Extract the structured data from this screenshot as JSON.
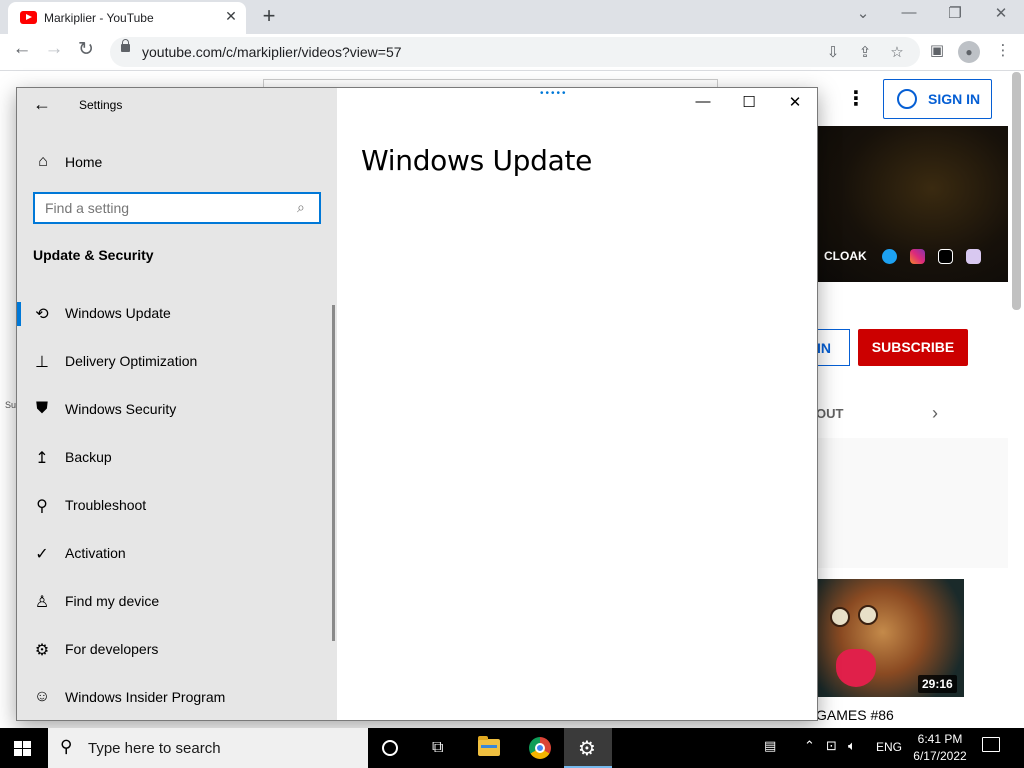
{
  "browser": {
    "tab_title": "Markiplier - YouTube",
    "tab_close_glyph": "✕",
    "new_tab_glyph": "+",
    "url": "youtube.com/c/markiplier/videos?view=57",
    "window_buttons": {
      "chevron": "⌄",
      "minimize": "—",
      "restore": "❐",
      "close": "✕"
    }
  },
  "youtube": {
    "sign_in_label": "SIGN IN",
    "banner_text": "CLOAK",
    "join_stub_text": "IN",
    "subscribe_label": "SUBSCRIBE",
    "about_stub_text": "OUT",
    "video_duration": "29:16",
    "video_title_fragment": "GAMES #86",
    "sidebar_fragment": "Su",
    "brand_red": "#cc0000",
    "link_blue": "#065fd4"
  },
  "settings": {
    "title": "Settings",
    "home_label": "Home",
    "search_placeholder": "Find a setting",
    "section_title": "Update & Security",
    "page_title": "Windows Update",
    "accent": "#0078d7",
    "nav_items": [
      {
        "label": "Windows Update",
        "icon": "sync-icon",
        "selected": true
      },
      {
        "label": "Delivery Optimization",
        "icon": "delivery-optimization-icon"
      },
      {
        "label": "Windows Security",
        "icon": "shield-icon"
      },
      {
        "label": "Backup",
        "icon": "backup-arrow-icon"
      },
      {
        "label": "Troubleshoot",
        "icon": "wrench-icon"
      },
      {
        "label": "Activation",
        "icon": "checkmark-circle-icon"
      },
      {
        "label": "Find my device",
        "icon": "person-location-icon"
      },
      {
        "label": "For developers",
        "icon": "developer-tools-icon"
      },
      {
        "label": "Windows Insider Program",
        "icon": "insider-cat-icon"
      }
    ]
  },
  "taskbar": {
    "search_placeholder": "Type here to search",
    "language": "ENG",
    "time": "6:41 PM",
    "date": "6/17/2022"
  }
}
